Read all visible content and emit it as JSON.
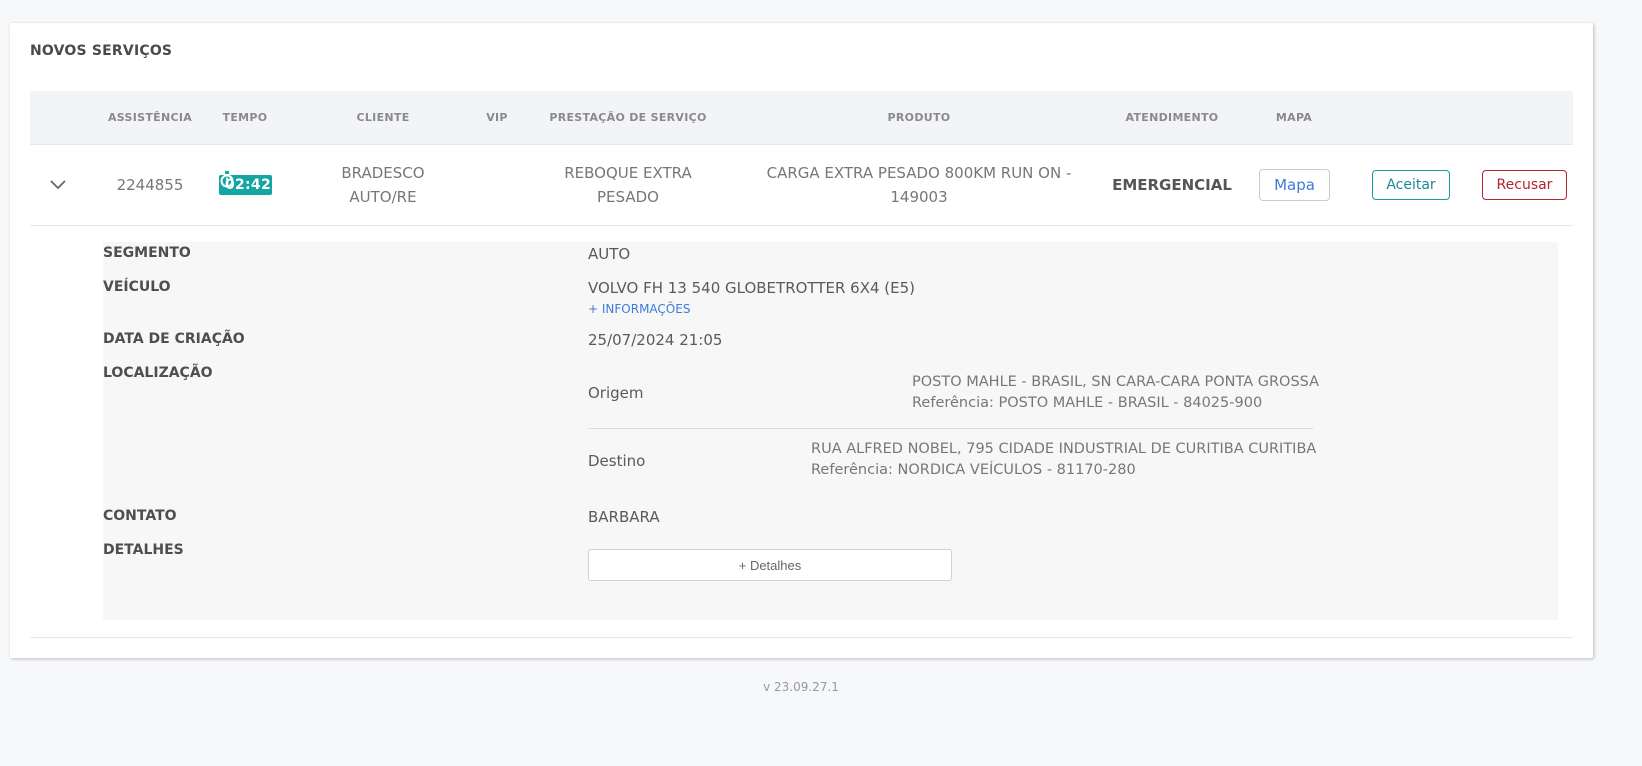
{
  "section": {
    "title": "NOVOS SERVIÇOS"
  },
  "columns": {
    "assistencia": "ASSISTÊNCIA",
    "tempo": "TEMPO",
    "cliente": "CLIENTE",
    "vip": "VIP",
    "prestacao": "PRESTAÇÃO DE SERVIÇO",
    "produto": "PRODUTO",
    "atendimento": "ATENDIMENTO",
    "mapa": "MAPA"
  },
  "row": {
    "assistencia": "2244855",
    "tempo": "02:42",
    "cliente_line1": "BRADESCO",
    "cliente_line2": "AUTO/RE",
    "vip": "",
    "prestacao_line1": "REBOQUE EXTRA",
    "prestacao_line2": "PESADO",
    "produto_line1": "CARGA EXTRA PESADO 800KM RUN ON -",
    "produto_line2": "149003",
    "atendimento": "EMERGENCIAL",
    "buttons": {
      "mapa": "Mapa",
      "aceitar": "Aceitar",
      "recusar": "Recusar"
    },
    "icons": {
      "expand": "chevron-down-icon",
      "timer": "stopwatch-icon"
    },
    "colors": {
      "timer": "#14a6a3",
      "aceitar": "#1a9aa6",
      "recusar": "#b3242e",
      "link": "#3d7bd9"
    }
  },
  "details": {
    "labels": {
      "segmento": "SEGMENTO",
      "veiculo": "VEÍCULO",
      "data_criacao": "DATA DE CRIAÇÃO",
      "localizacao": "LOCALIZAÇÃO",
      "contato": "CONTATO",
      "detalhes": "DETALHES"
    },
    "values": {
      "segmento": "AUTO",
      "veiculo": "VOLVO FH 13 540 GLOBETROTTER 6X4 (E5)",
      "info_link": "+ INFORMAÇÕES",
      "data_criacao": "25/07/2024 21:05",
      "contato": "BARBARA",
      "detalhes_button": "+ Detalhes"
    },
    "localizacao": {
      "origem_label": "Origem",
      "origem_address": "POSTO MAHLE - BRASIL, SN CARA-CARA PONTA GROSSA",
      "origem_reference": "Referência: POSTO MAHLE - BRASIL - 84025-900",
      "destino_label": "Destino",
      "destino_address": "RUA ALFRED NOBEL, 795 CIDADE INDUSTRIAL DE CURITIBA CURITIBA",
      "destino_reference": "Referência: NORDICA VEÍCULOS - 81170-280"
    }
  },
  "footer": {
    "version": "v 23.09.27.1"
  }
}
